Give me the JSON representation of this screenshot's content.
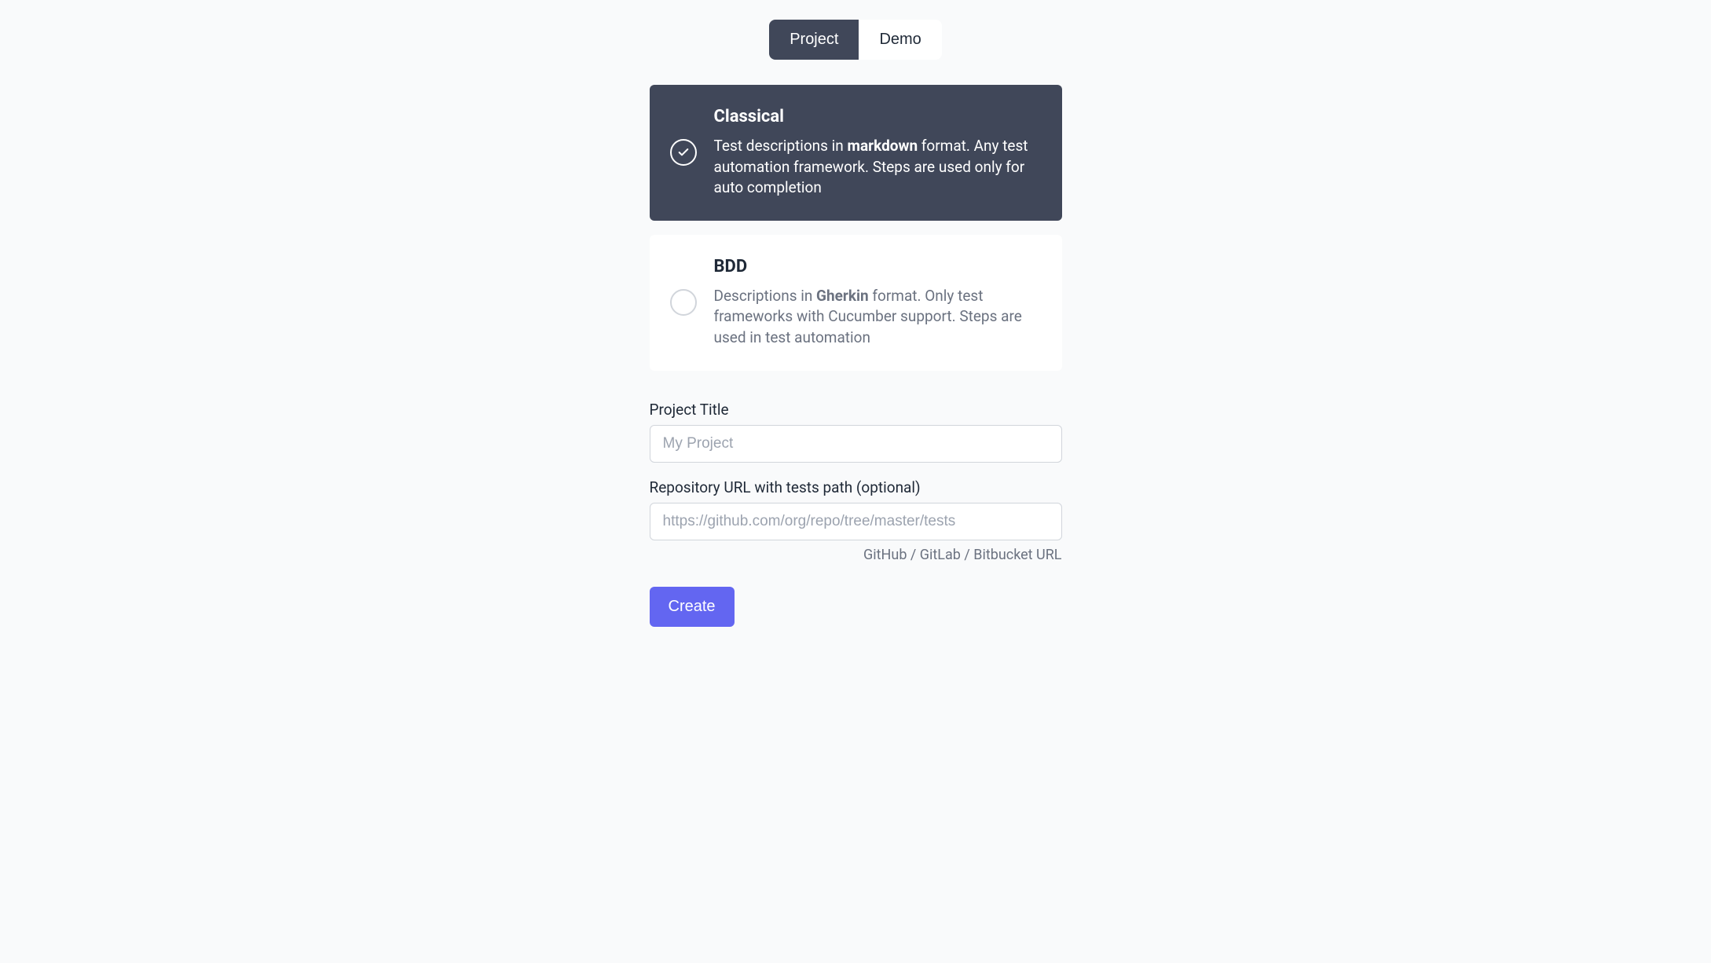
{
  "tabs": {
    "project": "Project",
    "demo": "Demo",
    "active": "project"
  },
  "options": {
    "classical": {
      "title": "Classical",
      "desc_pre": "Test descriptions in ",
      "desc_strong": "markdown",
      "desc_post": " format. Any test automation framework. Steps are used only for auto completion"
    },
    "bdd": {
      "title": "BDD",
      "desc_pre": "Descriptions in ",
      "desc_strong": "Gherkin",
      "desc_post": " format. Only test frameworks with Cucumber support. Steps are used in test automation"
    }
  },
  "fields": {
    "title_label": "Project Title",
    "title_placeholder": "My Project",
    "title_value": "",
    "repo_label": "Repository URL with tests path (optional)",
    "repo_placeholder": "https://github.com/org/repo/tree/master/tests",
    "repo_value": "",
    "repo_hint": "GitHub / GitLab / Bitbucket URL"
  },
  "buttons": {
    "create": "Create"
  }
}
